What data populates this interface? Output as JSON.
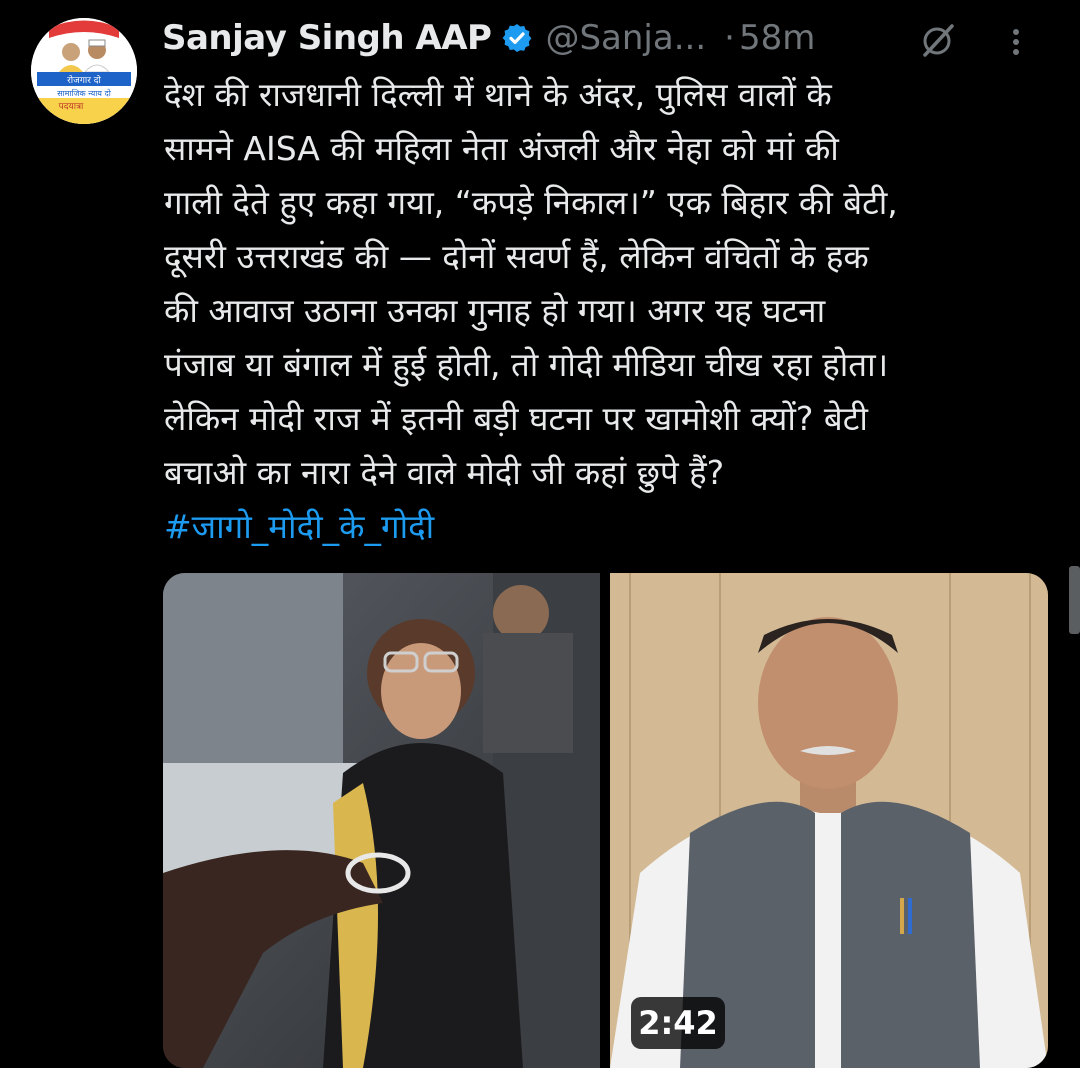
{
  "tweet": {
    "author_name": "Sanjay Singh AAP",
    "handle": "@Sanja...",
    "separator": "·",
    "time": "58m",
    "icons": {
      "verified": "verified-badge-icon",
      "grok": "grok-icon",
      "more": "more-options-icon"
    },
    "avatar_text": [
      "रोजगार दो",
      "सामाजिक न्याय दो",
      "पदयात्रा"
    ],
    "text_lines": [
      "देश की राजधानी दिल्ली में थाने के अंदर, पुलिस वालों के",
      "सामने AISA की महिला नेता अंजली और नेहा को मां की",
      "गाली देते हुए कहा गया, “कपड़े निकाल।” एक बिहार की बेटी,",
      "दूसरी उत्तराखंड की — दोनों सवर्ण हैं, लेकिन वंचितों के हक",
      "की आवाज उठाना उनका गुनाह हो गया। अगर यह घटना",
      "पंजाब या बंगाल में हुई होती, तो गोदी मीडिया चीख रहा होता।",
      "लेकिन मोदी राज में इतनी बड़ी घटना पर खामोशी क्यों? बेटी",
      "बचाओ का नारा देने वाले मोदी जी कहां छुपे हैं?"
    ],
    "hashtag": "#जागो_मोदी_के_गोदी",
    "media": {
      "video_duration": "2:42"
    }
  },
  "colors": {
    "background": "#000000",
    "text": "#e7e9ea",
    "muted": "#71767b",
    "link": "#1d9bf0",
    "verified": "#1d9bf0"
  }
}
